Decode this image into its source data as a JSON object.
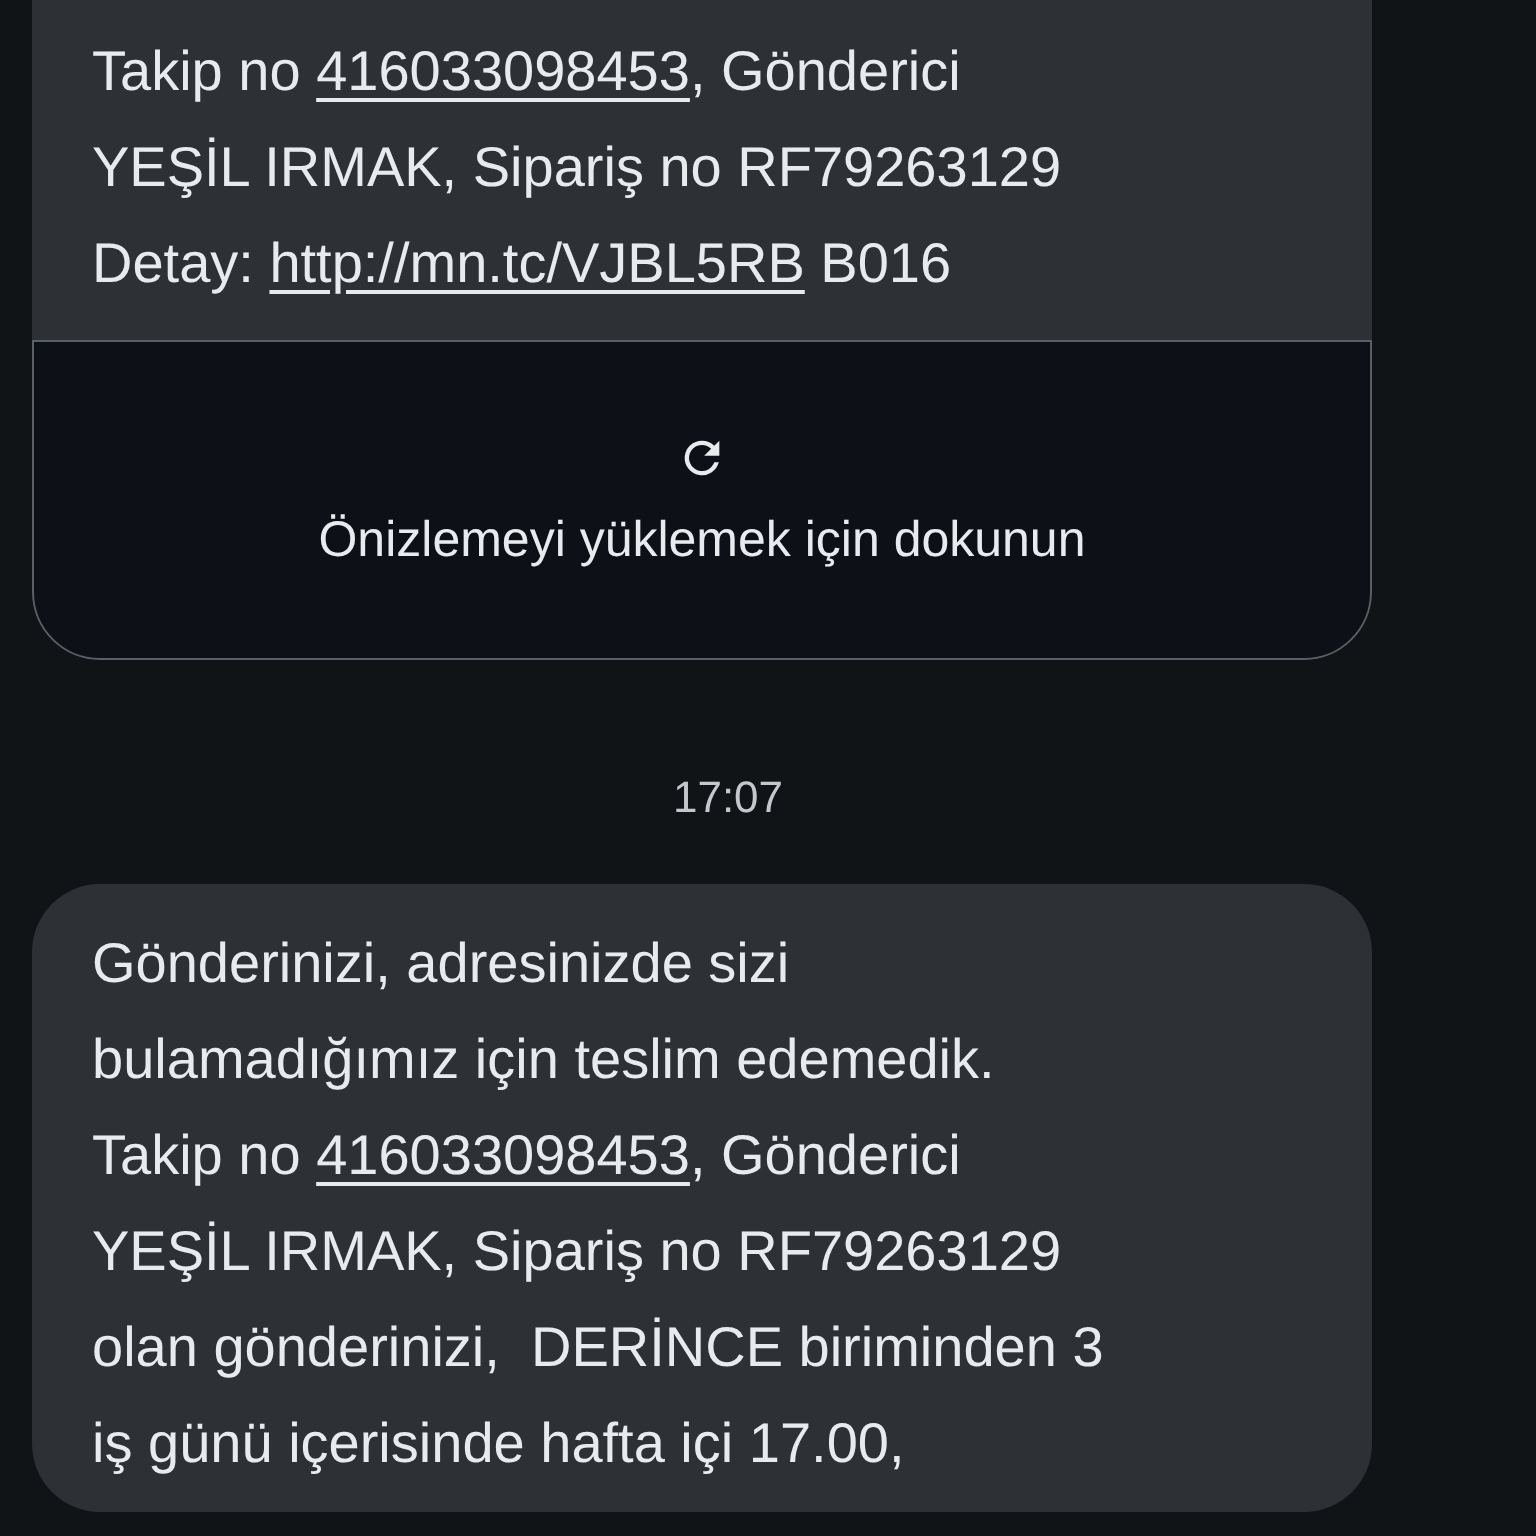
{
  "thread": [
    {
      "kind": "message",
      "lines": [
        [
          {
            "kind": "text",
            "text": "Takip no "
          },
          {
            "kind": "link",
            "text": "416033098453"
          },
          {
            "kind": "text",
            "text": ", Gönderici"
          }
        ],
        [
          {
            "kind": "text",
            "text": "YEŞİL IRMAK, Sipariş no RF79263129"
          }
        ],
        [
          {
            "kind": "text",
            "text": "Detay: "
          },
          {
            "kind": "link",
            "text": "http://mn.tc/VJBL5RB"
          },
          {
            "kind": "text",
            "text": " B016"
          }
        ]
      ],
      "preview": {
        "label": "Önizlemeyi yüklemek için dokunun"
      }
    },
    {
      "kind": "timestamp",
      "text": "17:07"
    },
    {
      "kind": "message",
      "lines": [
        [
          {
            "kind": "text",
            "text": "Gönderinizi, adresinizde sizi"
          }
        ],
        [
          {
            "kind": "text",
            "text": "bulamadığımız için teslim edemedik."
          }
        ],
        [
          {
            "kind": "text",
            "text": "Takip no "
          },
          {
            "kind": "link",
            "text": "416033098453"
          },
          {
            "kind": "text",
            "text": ", Gönderici"
          }
        ],
        [
          {
            "kind": "text",
            "text": "YEŞİL IRMAK, Sipariş no RF79263129"
          }
        ],
        [
          {
            "kind": "text",
            "text": "olan gönderinizi,  DERİNCE biriminden 3"
          }
        ],
        [
          {
            "kind": "text",
            "text": "iş günü içerisinde hafta içi 17.00,"
          }
        ]
      ]
    }
  ]
}
